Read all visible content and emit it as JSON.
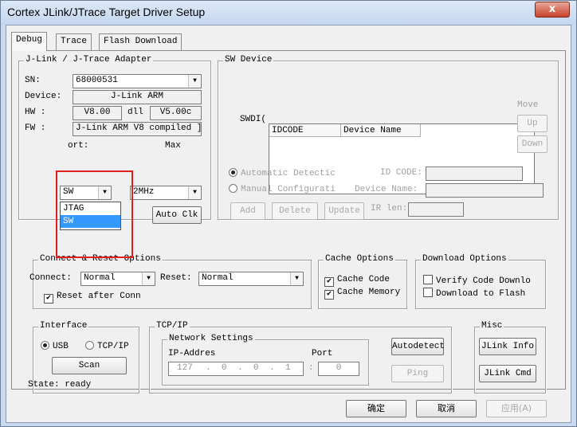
{
  "window": {
    "title": "Cortex JLink/JTrace Target Driver Setup",
    "close": "x"
  },
  "tabs": [
    "Debug",
    "Trace",
    "Flash Download"
  ],
  "adapter": {
    "title": "J-Link / J-Trace Adapter",
    "sn_label": "SN:",
    "sn_value": "68000531",
    "device_label": "Device:",
    "device_value": "J-Link ARM",
    "hw_label": "HW :",
    "hw_value": "V8.00",
    "dll_label": "dll",
    "dll_value": "V5.00c",
    "fw_label": "FW :",
    "fw_value": "J-Link ARM V8 compiled ]",
    "port_label": "ort:",
    "max_label": "Max",
    "port_value": "SW",
    "max_value": "2MHz",
    "port_options": [
      "JTAG",
      "SW"
    ],
    "autoclk": "Auto Clk"
  },
  "swdevice": {
    "title": "SW Device",
    "swd_label": "SWDI(",
    "col_idcode": "IDCODE",
    "col_devname": "Device Name",
    "move_label": "Move",
    "up": "Up",
    "down": "Down",
    "auto_detect": "Automatic Detectic",
    "manual_config": "Manual Configurati",
    "idcode_label": "ID CODE:",
    "devname_label": "Device Name:",
    "irlen_label": "IR len:",
    "add": "Add",
    "delete": "Delete",
    "update": "Update"
  },
  "connect": {
    "title": "Connect & Reset Options",
    "connect_label": "Connect:",
    "connect_value": "Normal",
    "reset_label": "Reset:",
    "reset_value": "Normal",
    "reset_after": "Reset after Conn"
  },
  "cache": {
    "title": "Cache Options",
    "code": "Cache Code",
    "memory": "Cache Memory"
  },
  "download": {
    "title": "Download Options",
    "verify": "Verify Code Downlo",
    "to_flash": "Download to Flash"
  },
  "interface": {
    "title": "Interface",
    "usb": "USB",
    "tcpip": "TCP/IP",
    "scan": "Scan",
    "state": "State: ready"
  },
  "tcpip": {
    "title": "TCP/IP",
    "network": "Network Settings",
    "ip_label": "IP-Addres",
    "port_label": "Port",
    "ip1": "127",
    "ip2": "0",
    "ip3": "0",
    "ip4": "1",
    "port_value": "0",
    "autodetect": "Autodetect",
    "ping": "Ping"
  },
  "misc": {
    "title": "Misc",
    "jlink_info": "JLink Info",
    "jlink_cmd": "JLink Cmd"
  },
  "footer": {
    "ok": "确定",
    "cancel": "取消",
    "apply": "应用(A)"
  }
}
